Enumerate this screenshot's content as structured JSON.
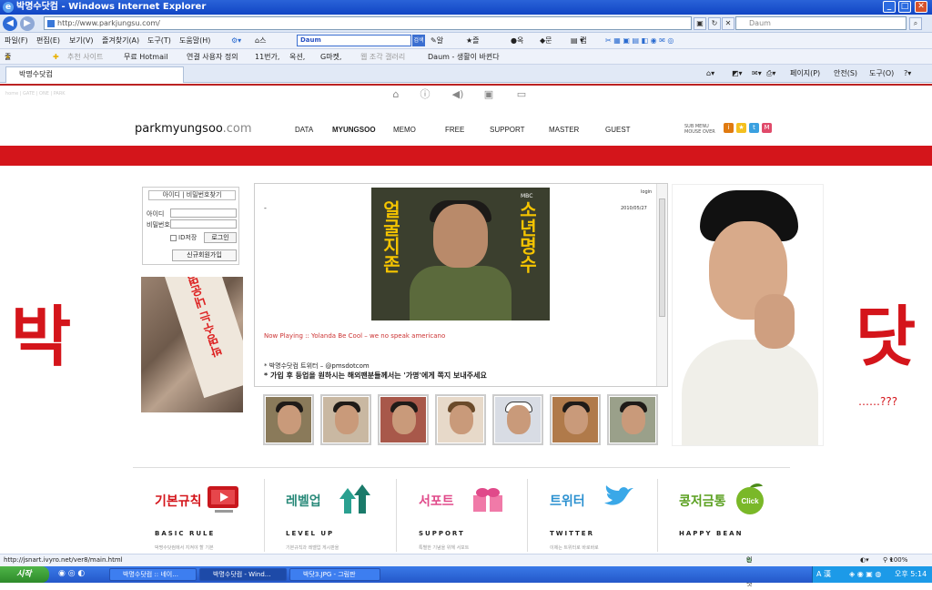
{
  "window": {
    "title": "박명수닷컴 - Windows Internet Explorer",
    "min": "_",
    "max": "□",
    "close": "✕"
  },
  "address": {
    "url": "http://www.parkjungsu.com/",
    "search_placeholder": "Daum"
  },
  "menu": {
    "items": [
      "파일(F)",
      "편집(E)",
      "보기(V)",
      "즐겨찾기(A)",
      "도구(T)",
      "도움말(H)"
    ],
    "smart_home": "스마트홈",
    "daum_logo": "Daum",
    "daum_go": "검색",
    "tools": [
      "알리소",
      "즐겨찾기",
      "옥션",
      "문자",
      "캡처"
    ]
  },
  "favorites": {
    "label": "즐겨찾기",
    "items": [
      "추천 사이트",
      "무료 Hotmail",
      "연결 사용자 정의",
      "11번가,",
      "옥션,",
      "G마켓,",
      "웹 조각 갤러리",
      "Daum - 생활이 바뀐다"
    ]
  },
  "tab": {
    "title": "박명수닷컴",
    "tools": [
      "페이지(P)",
      "안전(S)",
      "도구(O)"
    ]
  },
  "site": {
    "brand_name": "parkmyungsoo",
    "brand_tld": ".com",
    "nav": [
      "DATA",
      "MYUNGSOO",
      "MEMO",
      "FREE",
      "SUPPORT",
      "MASTER",
      "GUEST"
    ],
    "submenu_line1": "SUB MENU",
    "submenu_line2": "MOUSE OVER",
    "big_left": "박",
    "big_right": "닷",
    "qq": "……???",
    "top_link": "home | GATE | ONE | PARK"
  },
  "login": {
    "find": "아이디 | 비밀번호찾기",
    "id_label": "아이디",
    "pw_label": "비밀번호",
    "remember": "ID저장",
    "login_btn": "로그인",
    "join_btn": "신규회원가입"
  },
  "center": {
    "login_link": "login",
    "date": "2010/05/27",
    "dash": "-",
    "poster_left": "얼굴지존",
    "poster_right": "소년명수",
    "poster_mbc": "MBC",
    "now_playing": "Now Playing :: Yolanda Be Cool – we no speak americano",
    "twitter": "* 박명수닷컴 트위터 – @pmsdotcom",
    "notice": "* 가입 후 등업을 원하시는 해외팬분들께서는 '가명'에게 쪽지 보내주세요"
  },
  "leftphoto": {
    "text": "박명수는 내운명"
  },
  "footer": [
    {
      "kr": "기본규칙",
      "en": "BASIC RULE",
      "sub": "박명수닷컴에서 지켜야 할 기본"
    },
    {
      "kr": "레벨업",
      "en": "LEVEL UP",
      "sub": "기본규칙과 레벨업 게시판을"
    },
    {
      "kr": "서포트",
      "en": "SUPPORT",
      "sub": "특별한 기념을 위해 서포트"
    },
    {
      "kr": "트위터",
      "en": "TWITTER",
      "sub": "이제는 트위터로 바로바로"
    },
    {
      "kr": "콩저금통",
      "en": "HAPPY BEAN",
      "sub": "",
      "badge": "Click"
    }
  ],
  "status": {
    "url": "http://jsnart.ivyro.net/ver8/main.html",
    "zone": "인터넷",
    "zoom": "100%"
  },
  "taskbar": {
    "start": "시작",
    "tasks": [
      "박명수닷컴 :: 네이...",
      "박명수닷컴 - Wind...",
      "박닷3.JPG - 그림판"
    ],
    "tray_ime": "A 漢",
    "clock": "오후 5:14"
  }
}
